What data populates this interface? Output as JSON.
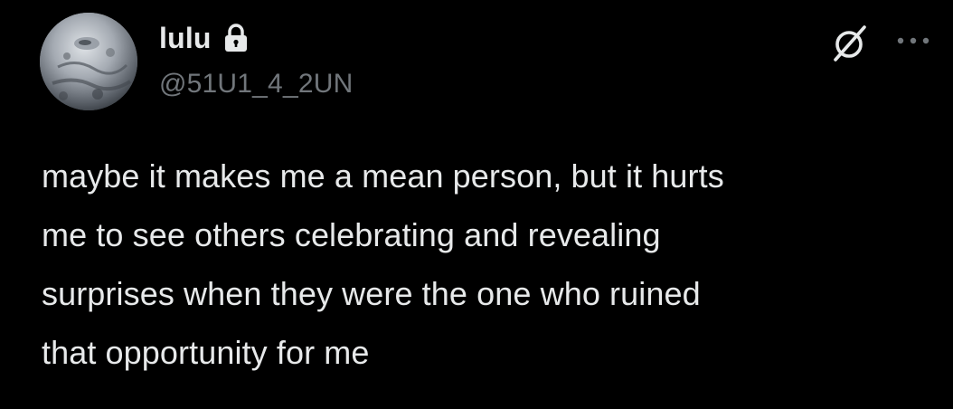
{
  "author": {
    "display_name": "lulu",
    "handle": "@51U1_4_2UN",
    "protected_icon": "lock-icon",
    "avatar": "avatar-image"
  },
  "header_actions": {
    "grok_icon": "grok-icon",
    "more_icon": "more-dots-icon"
  },
  "tweet": {
    "text": "maybe it makes me a mean person, but it hurts\nme to see others celebrating and revealing\nsurprises when they were the one who ruined\nthat opportunity for me"
  },
  "colors": {
    "background": "#000000",
    "text_primary": "#e7e9ea",
    "text_secondary": "#71767b"
  }
}
